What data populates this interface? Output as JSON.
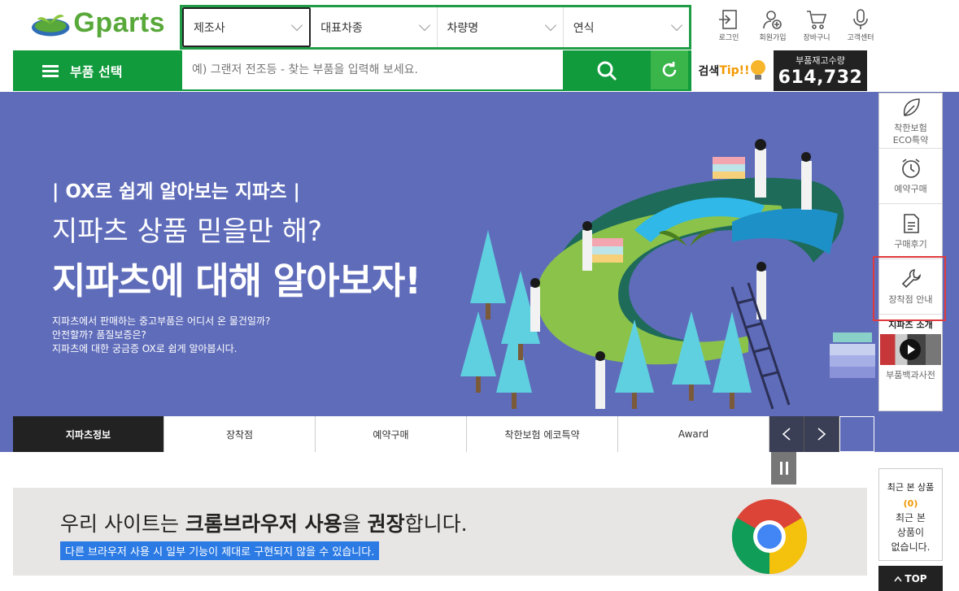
{
  "brand": {
    "name": "Gparts",
    "green": "#119b3d",
    "logo_green": "#58a83a"
  },
  "filters": [
    {
      "label": "제조사"
    },
    {
      "label": "대표차종"
    },
    {
      "label": "차량명"
    },
    {
      "label": "연식"
    }
  ],
  "top_links": [
    {
      "label": "로그인",
      "icon": "login-icon"
    },
    {
      "label": "회원가입",
      "icon": "user-add-icon"
    },
    {
      "label": "장바구니",
      "icon": "cart-icon"
    },
    {
      "label": "고객센터",
      "icon": "mic-icon"
    }
  ],
  "nav": {
    "menu_label": "부품 선택",
    "search_placeholder": "예) 그랜저 전조등 - 찾는 부품을 입력해 보세요."
  },
  "search_tip": {
    "prefix": "검색",
    "tip": "Tip!!"
  },
  "stock": {
    "label": "부품재고수량",
    "value": "614,732"
  },
  "banner": {
    "background": "#5f6cba",
    "kicker": "| OX로 쉽게 알아보는 지파츠 |",
    "headline_2": "지파츠 상품 믿을만 해?",
    "headline_1": "지파츠에 대해 알아보자!",
    "desc_lines": [
      "지파츠에서 판매하는 중고부품은 어디서 온 물건일까?",
      "안전할까? 품질보증은?",
      "지파츠에 대한 궁금증 OX로 쉽게 알아봅시다."
    ]
  },
  "banner_tabs": [
    {
      "label": "지파츠정보",
      "active": true
    },
    {
      "label": "장착점",
      "active": false
    },
    {
      "label": "예약구매",
      "active": false
    },
    {
      "label": "착한보험 에코특약",
      "active": false
    },
    {
      "label": "Award",
      "active": false
    }
  ],
  "quick_menu": [
    {
      "label": "착한보험\nECO특약",
      "icon": "leaf-icon"
    },
    {
      "label": "예약구매",
      "icon": "alarm-clock-icon"
    },
    {
      "label": "구매후기",
      "icon": "document-icon"
    },
    {
      "label": "장착점 안내",
      "icon": "wrench-icon",
      "highlight": true
    }
  ],
  "quick_video": {
    "title": "지파츠 소개",
    "subtitle": "부품백과사전"
  },
  "chrome_notice": {
    "pre": "우리 사이트는 ",
    "bold1": "크롬브라우저 사용",
    "mid": "을 ",
    "bold2": "권장",
    "post": "합니다.",
    "sub": "다른 브라우저 사용 시 일부 기능이 제대로 구현되지 않을 수 있습니다."
  },
  "recent": {
    "title": "최근 본 상품",
    "count": "(0)",
    "empty": "최근 본\n상품이\n없습니다."
  },
  "top_button": "TOP"
}
